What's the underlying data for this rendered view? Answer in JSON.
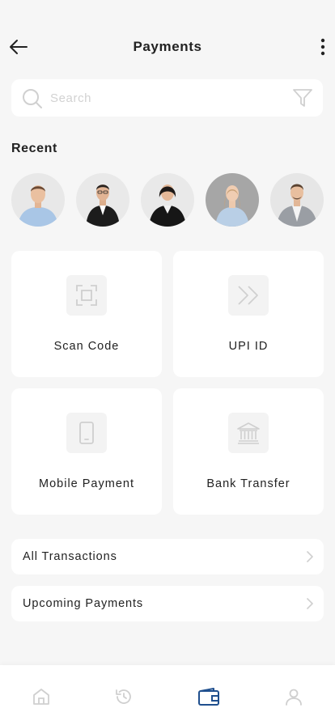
{
  "header": {
    "title": "Payments",
    "back_icon": "arrow-left-icon",
    "more_icon": "more-vertical-icon"
  },
  "search": {
    "placeholder": "Search",
    "value": "",
    "search_icon": "search-icon",
    "filter_icon": "filter-icon"
  },
  "recent": {
    "title": "Recent",
    "contacts": [
      {
        "avatar": "avatar-man-light-blue-shirt"
      },
      {
        "avatar": "avatar-man-black-suit"
      },
      {
        "avatar": "avatar-woman-black-blazer"
      },
      {
        "avatar": "avatar-woman-denim-shirt"
      },
      {
        "avatar": "avatar-man-grey-blazer"
      }
    ]
  },
  "actions": [
    {
      "label": "Scan Code",
      "icon": "scan-icon"
    },
    {
      "label": "UPI ID",
      "icon": "double-chevron-right-icon"
    },
    {
      "label": "Mobile Payment",
      "icon": "smartphone-icon"
    },
    {
      "label": "Bank Transfer",
      "icon": "bank-icon"
    }
  ],
  "links": [
    {
      "label": "All Transactions",
      "icon": "chevron-right-icon"
    },
    {
      "label": "Upcoming Payments",
      "icon": "chevron-right-icon"
    }
  ],
  "tabbar": {
    "tabs": [
      {
        "name": "home",
        "icon": "home-icon",
        "active": false
      },
      {
        "name": "history",
        "icon": "history-icon",
        "active": false
      },
      {
        "name": "wallet",
        "icon": "wallet-icon",
        "active": true
      },
      {
        "name": "profile",
        "icon": "user-icon",
        "active": false
      }
    ],
    "active_color": "#1f4f8e",
    "inactive_color": "#cfcfcf"
  }
}
